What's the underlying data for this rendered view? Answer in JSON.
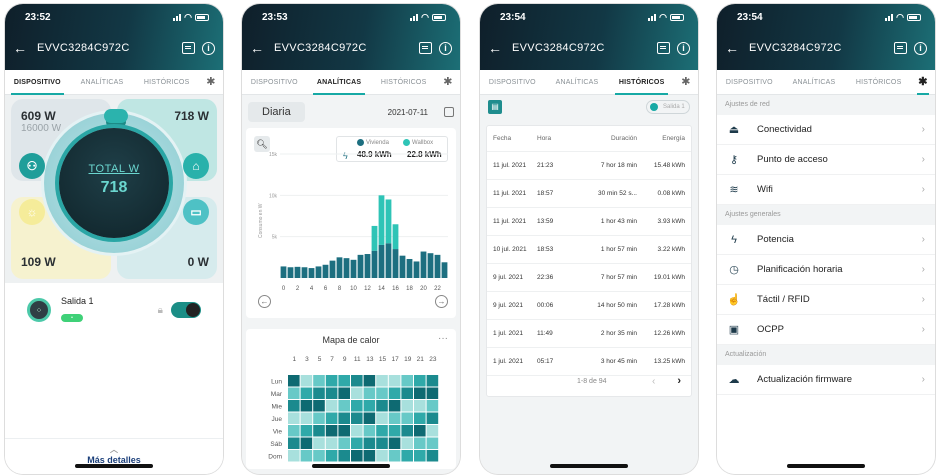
{
  "status": {
    "p1_time": "23:52",
    "p2_time": "23:53",
    "p3_time": "23:54",
    "p4_time": "23:54"
  },
  "header": {
    "title": "EVVC3284C972C"
  },
  "tabs": {
    "dispositivo": "DISPOSITIVO",
    "analiticas": "ANALÍTICAS",
    "historicos": "HISTÓRICOS"
  },
  "screen1": {
    "q1_value": "609 W",
    "q1_sub": "16000 W",
    "q2_value": "718 W",
    "q3_value": "109 W",
    "q4_value": "0 W",
    "total_label": "TOTAL W",
    "total_value": "718",
    "outlet_name": "Salida 1",
    "more_label": "Más detalles"
  },
  "screen2": {
    "period": "Diaria",
    "date": "2021-07-11",
    "legend_vivienda": "Vivienda",
    "legend_vivienda_value": "48.9 kWh",
    "legend_wallbox": "Wallbox",
    "legend_wallbox_value": "22.8 kWh",
    "heatmap_title": "Mapa de calor",
    "heat_x": [
      "1",
      "3",
      "5",
      "7",
      "9",
      "11",
      "13",
      "15",
      "17",
      "19",
      "21",
      "23"
    ],
    "heat_y": [
      "Lun",
      "Mar",
      "Mie",
      "Jue",
      "Vie",
      "Sáb",
      "Dom"
    ]
  },
  "chart_data": {
    "type": "bar",
    "categories": [
      "0",
      "1",
      "2",
      "3",
      "4",
      "5",
      "6",
      "7",
      "8",
      "9",
      "10",
      "11",
      "12",
      "13",
      "14",
      "15",
      "16",
      "17",
      "18",
      "19",
      "20",
      "21",
      "22",
      "23"
    ],
    "x_tick_labels": [
      "0",
      "2",
      "4",
      "6",
      "8",
      "10",
      "12",
      "14",
      "16",
      "18",
      "20",
      "22"
    ],
    "ylabel": "Consumo en W",
    "ytick_labels": [
      "15k",
      "10k",
      "5k"
    ],
    "ylim": [
      0,
      15000
    ],
    "series": [
      {
        "name": "Vivienda",
        "values": [
          1400,
          1300,
          1350,
          1300,
          1200,
          1400,
          1600,
          2100,
          2500,
          2400,
          2200,
          2800,
          2900,
          3300,
          4000,
          4200,
          3500,
          2700,
          2300,
          2000,
          3200,
          3000,
          2800,
          1900
        ]
      },
      {
        "name": "Wallbox",
        "values": [
          0,
          0,
          0,
          0,
          0,
          0,
          0,
          0,
          0,
          0,
          0,
          0,
          0,
          3000,
          6000,
          5300,
          3000,
          0,
          0,
          0,
          0,
          0,
          0,
          0
        ]
      }
    ]
  },
  "screen3": {
    "cols": [
      "Fecha",
      "Hora",
      "Duración",
      "Energía"
    ],
    "rows": [
      [
        "11 jul. 2021",
        "21:23",
        "7 hor 18 min",
        "15.48 kWh"
      ],
      [
        "11 jul. 2021",
        "18:57",
        "30 min 52 s...",
        "0.08 kWh"
      ],
      [
        "11 jul. 2021",
        "13:59",
        "1 hor 43 min",
        "3.93 kWh"
      ],
      [
        "10 jul. 2021",
        "18:53",
        "1 hor 57 min",
        "3.22 kWh"
      ],
      [
        "9 jul. 2021",
        "22:36",
        "7 hor 57 min",
        "19.01 kWh"
      ],
      [
        "9 jul. 2021",
        "00:06",
        "14 hor 50 min",
        "17.28 kWh"
      ],
      [
        "1 jul. 2021",
        "11:49",
        "2 hor 35 min",
        "12.26 kWh"
      ],
      [
        "1 jul. 2021",
        "05:17",
        "3 hor 45 min",
        "13.25 kWh"
      ]
    ],
    "pager": "1-8 de 94",
    "outlet_chip": "Salida 1"
  },
  "screen4": {
    "sec_red": "Ajustes de red",
    "conectividad": "Conectividad",
    "punto": "Punto de acceso",
    "wifi": "Wifi",
    "sec_generales": "Ajustes generales",
    "potencia": "Potencia",
    "planificacion": "Planificación horaria",
    "tactil": "Táctil / RFID",
    "ocpp": "OCPP",
    "sec_actualizacion": "Actualización",
    "firmware": "Actualización firmware"
  },
  "colors": {
    "accent": "#17a9a5",
    "vivienda": "#1d6f80",
    "wallbox": "#2ec4b6",
    "header_dark": "#0f1f2a"
  }
}
